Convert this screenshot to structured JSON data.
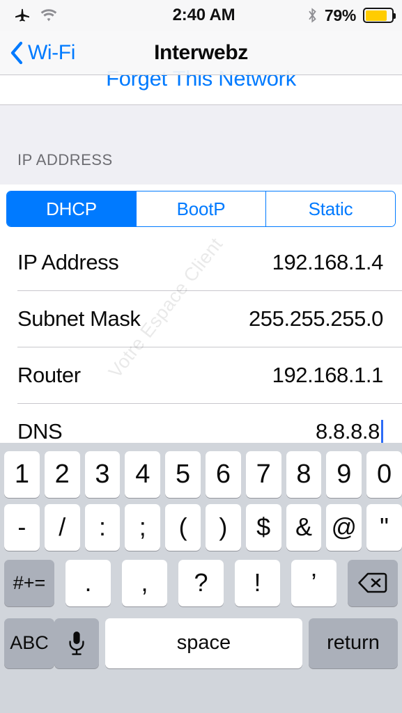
{
  "status_bar": {
    "airplane_icon": "airplane-mode-icon",
    "wifi_icon": "wifi-icon",
    "time": "2:40 AM",
    "bluetooth_icon": "bluetooth-icon",
    "battery_percent": "79%",
    "battery_level": 79,
    "battery_color": "#ffcc00"
  },
  "nav_bar": {
    "back_icon": "chevron-left-icon",
    "back_label": "Wi-Fi",
    "title": "Interwebz",
    "tint_color": "#007aff"
  },
  "content": {
    "forget_network_label": "Forget This Network",
    "section_header": "IP ADDRESS",
    "segmented_control": {
      "options": [
        "DHCP",
        "BootP",
        "Static"
      ],
      "selected_index": 0
    },
    "rows": [
      {
        "label": "IP Address",
        "value": "192.168.1.4",
        "has_caret": false
      },
      {
        "label": "Subnet Mask",
        "value": "255.255.255.0",
        "has_caret": false
      },
      {
        "label": "Router",
        "value": "192.168.1.1",
        "has_caret": false
      },
      {
        "label": "DNS",
        "value": "8.8.8.8",
        "has_caret": true
      }
    ],
    "watermark": "Votre Espace Client"
  },
  "keyboard": {
    "row1": [
      "1",
      "2",
      "3",
      "4",
      "5",
      "6",
      "7",
      "8",
      "9",
      "0"
    ],
    "row2": [
      "-",
      "/",
      ":",
      ";",
      "(",
      ")",
      "$",
      "&",
      "@",
      "\""
    ],
    "row3": {
      "shift_label": "#+=",
      "keys": [
        ".",
        ",",
        "?",
        "!",
        "’"
      ],
      "backspace_icon": "backspace-icon"
    },
    "row4": {
      "abc_label": "ABC",
      "mic_icon": "microphone-icon",
      "space_label": "space",
      "return_label": "return"
    }
  }
}
